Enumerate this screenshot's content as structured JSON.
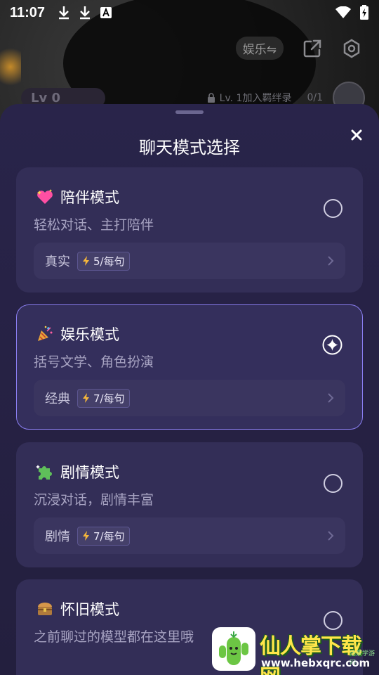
{
  "status_bar": {
    "time": "11:07",
    "left_icons": [
      "download-icon",
      "download-icon",
      "font-icon"
    ],
    "right_icons": [
      "wifi-icon",
      "battery-charging-icon"
    ]
  },
  "background": {
    "mode_chip": "娱乐⇋",
    "level_badge": "Lv 0",
    "lock_text": "Lv. 1加入羁绊录",
    "progress": "0/1"
  },
  "sheet": {
    "title": "聊天模式选择"
  },
  "cards": [
    {
      "emoji": "sparkling-heart-icon",
      "title": "陪伴模式",
      "subtitle": "轻松对话、主打陪伴",
      "footer_label": "真实",
      "cost": "5/每句",
      "selected": false
    },
    {
      "emoji": "party-popper-icon",
      "title": "娱乐模式",
      "subtitle": "括号文学、角色扮演",
      "footer_label": "经典",
      "cost": "7/每句",
      "selected": true
    },
    {
      "emoji": "puzzle-icon",
      "title": "剧情模式",
      "subtitle": "沉浸对话，剧情丰富",
      "footer_label": "剧情",
      "cost": "7/每句",
      "selected": false
    },
    {
      "emoji": "treasure-chest-icon",
      "title": "怀旧模式",
      "subtitle": "之前聊过的模型都在这里哦",
      "footer_label": "",
      "cost": "",
      "selected": false
    }
  ],
  "watermark": {
    "text": "仙人掌下载网",
    "url": "www.hebxqrc.com",
    "sub": "远景学游网"
  },
  "colors": {
    "sheet_bg": "#29244a",
    "card_bg": "#332e57",
    "selected_border": "#8a7ef0",
    "cost_bolt": "#f5b63a"
  }
}
